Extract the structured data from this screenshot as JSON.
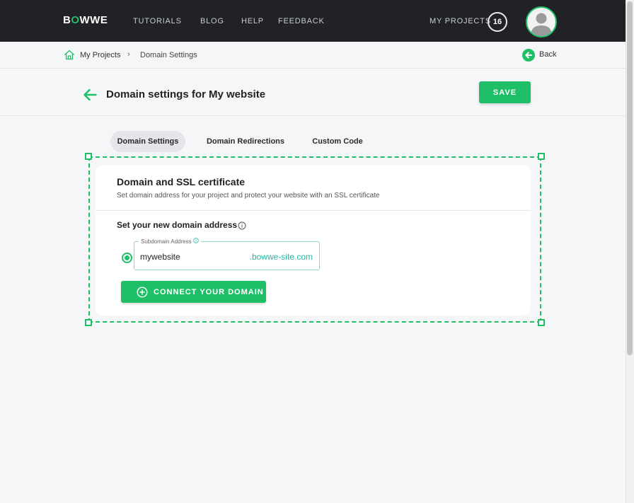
{
  "brand": {
    "logo_pre": "B",
    "logo_o": "O",
    "logo_post": "WWE"
  },
  "nav": {
    "tutorials": "TUTORIALS",
    "blog": "BLOG",
    "help": "HELP",
    "feedback": "FEEDBACK",
    "my_projects": "MY PROJECTS",
    "projects_count": "16"
  },
  "breadcrumb": {
    "home": "My Projects",
    "separator": "›",
    "current": "Domain Settings",
    "back": "Back"
  },
  "header": {
    "title": "Domain settings for My website",
    "save": "SAVE"
  },
  "tabs": [
    {
      "label": "Domain Settings",
      "active": true
    },
    {
      "label": "Domain Redirections",
      "active": false
    },
    {
      "label": "Custom Code",
      "active": false
    }
  ],
  "card": {
    "title": "Domain and SSL certificate",
    "subtitle": "Set domain address for your project and protect your website with an SSL certificate",
    "set_label": "Set your new domain address",
    "field_label": "Subdomain Address",
    "field_value": "mywebsite",
    "field_suffix": ".bowwe-site.com",
    "connect": "CONNECT YOUR DOMAIN"
  },
  "colors": {
    "accent": "#1fbf68",
    "topbar": "#202226",
    "suffix": "#26b5a3"
  },
  "icons": [
    "home-icon",
    "chevron-right-icon",
    "back-arrow-icon",
    "arrow-left-icon",
    "info-icon",
    "plus-circle-icon",
    "avatar-user-icon"
  ]
}
